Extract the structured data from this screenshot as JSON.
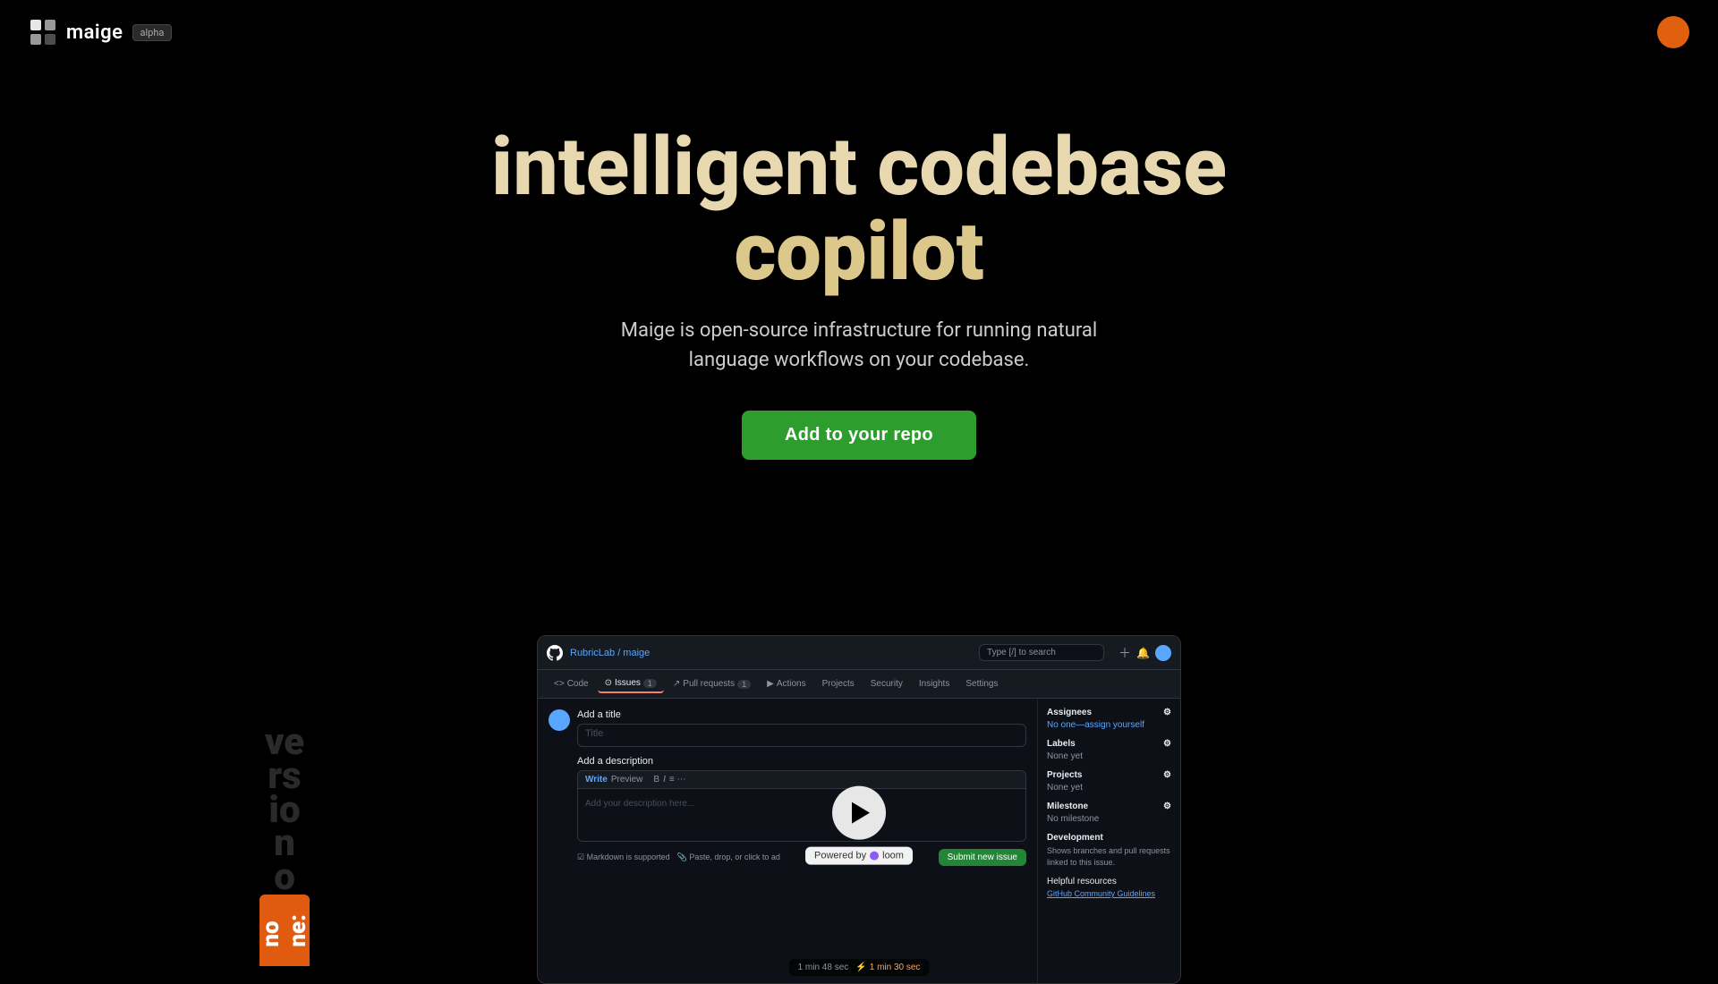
{
  "nav": {
    "logo_text": "maige",
    "alpha_label": "alpha",
    "user_color": "#e06010"
  },
  "hero": {
    "title_line1": "intelligent codebase",
    "title_line2": "copilot",
    "subtitle": "Maige is open-source infrastructure for running natural language workflows on your codebase.",
    "cta_label": "Add to your repo"
  },
  "github_mock": {
    "breadcrumb": "RubricLab / maige",
    "search_placeholder": "Type [/] to search",
    "tabs": [
      {
        "label": "Code",
        "active": false,
        "count": null
      },
      {
        "label": "Issues",
        "active": true,
        "count": "1"
      },
      {
        "label": "Pull requests",
        "active": false,
        "count": "1"
      },
      {
        "label": "Actions",
        "active": false,
        "count": null
      },
      {
        "label": "Projects",
        "active": false,
        "count": null
      },
      {
        "label": "Security",
        "active": false,
        "count": null
      },
      {
        "label": "Insights",
        "active": false,
        "count": null
      },
      {
        "label": "Settings",
        "active": false,
        "count": null
      }
    ],
    "issue_title_placeholder": "Title",
    "issue_add_title": "Add a title",
    "issue_add_description": "Add a description",
    "editor_tabs": [
      "Write",
      "Preview"
    ],
    "editor_placeholder": "Add your description here...",
    "markdown_note": "Markdown is supported",
    "paste_note": "Paste, drop, or click to ad",
    "submit_btn": "Submit new issue",
    "sidebar": {
      "assignees_label": "Assignees",
      "assignees_value": "No one—assign yourself",
      "labels_label": "Labels",
      "labels_value": "None yet",
      "projects_label": "Projects",
      "projects_value": "None yet",
      "milestone_label": "Milestone",
      "milestone_value": "No milestone",
      "development_label": "Development",
      "development_text": "Shows branches and pull requests linked to this issue.",
      "helpful_label": "Helpful resources",
      "helpful_link": "GitHub Community Guidelines"
    },
    "powered_by": "Powered by",
    "loom_label": "loom",
    "timer1": "1 min 48 sec",
    "timer2": "1 min 30 sec",
    "lightning": "⚡"
  },
  "version_ribbon": {
    "text": "version\no\nn\no\nn\ne:"
  }
}
